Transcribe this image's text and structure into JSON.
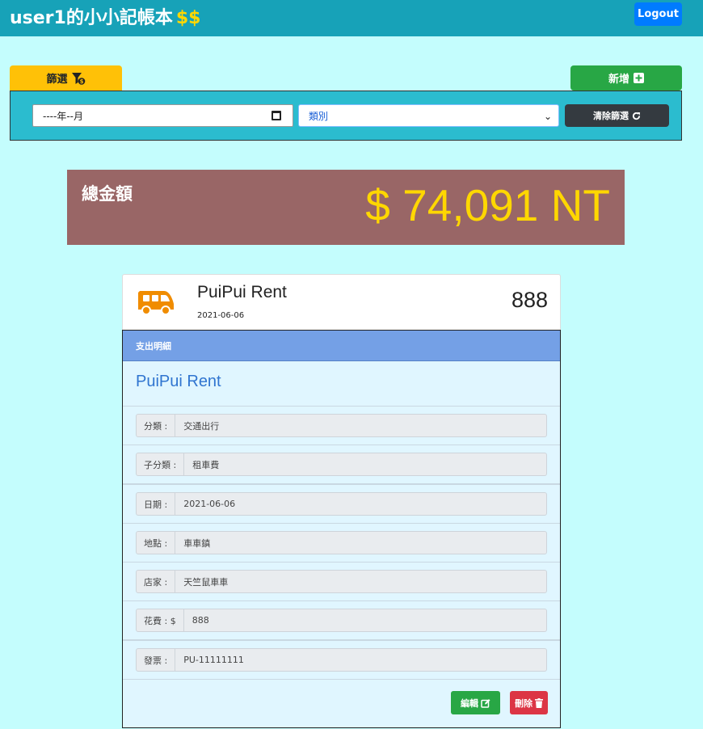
{
  "navbar": {
    "brand": "user1的小小記帳本",
    "brand_suffix": "$$",
    "logout_label": "Logout"
  },
  "toolbar": {
    "filter_label": "篩選",
    "add_label": "新增"
  },
  "filters": {
    "month_value": "----年--月",
    "category_selected": "類別",
    "clear_label": "清除篩選"
  },
  "total": {
    "label": "總金額",
    "amount": "$ 74,091 NT"
  },
  "record": {
    "title": "PuiPui Rent",
    "date": "2021-06-06",
    "amount": "888",
    "icon": "bus-icon"
  },
  "detail": {
    "header": "支出明細",
    "title": "PuiPui Rent",
    "fields": [
      {
        "label": "分類 :",
        "value": "交通出行"
      },
      {
        "label": "子分類 :",
        "value": "租車費"
      },
      {
        "label": "日期 :",
        "value": "2021-06-06"
      },
      {
        "label": "地點 :",
        "value": "車車鎮"
      },
      {
        "label": "店家 :",
        "value": "天竺鼠車車"
      },
      {
        "label": "花費 : $",
        "value": "888"
      },
      {
        "label": "發票 :",
        "value": "PU-11111111"
      }
    ],
    "edit_label": "編輯",
    "delete_label": "刪除"
  },
  "colors": {
    "navbar": "#17a2b8",
    "background": "#c4fdfd",
    "total_bg": "#996666",
    "total_amount": "#ffd700",
    "detail_header": "#74a0e6"
  }
}
